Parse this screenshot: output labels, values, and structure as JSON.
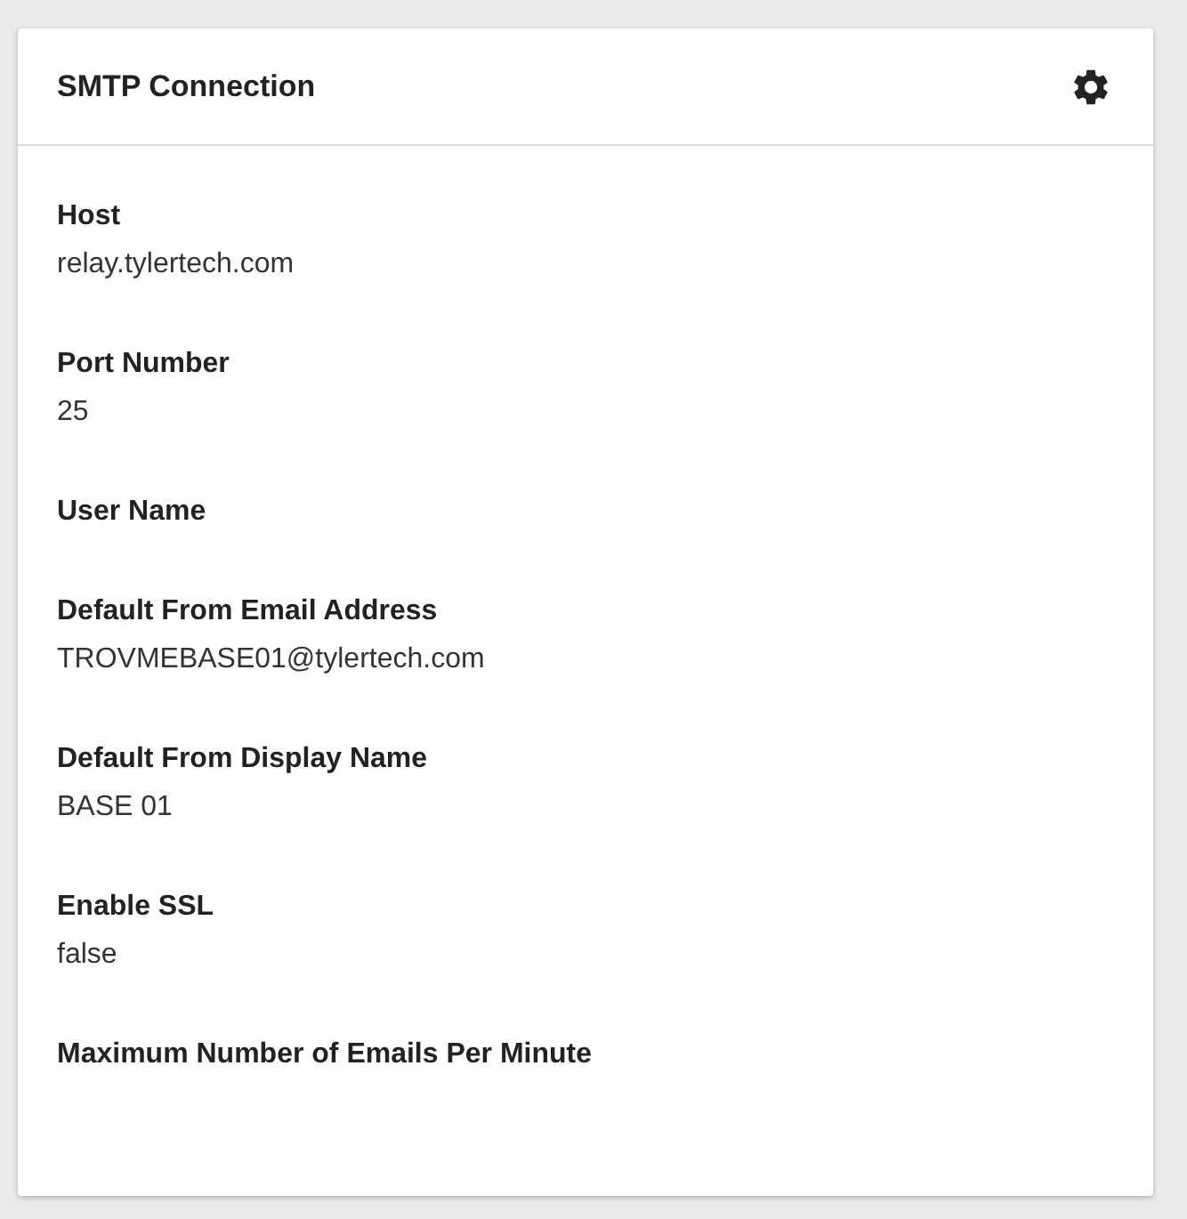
{
  "card": {
    "title": "SMTP Connection"
  },
  "fields": [
    {
      "label": "Host",
      "value": "relay.tylertech.com"
    },
    {
      "label": "Port Number",
      "value": "25"
    },
    {
      "label": "User Name"
    },
    {
      "label": "Default From Email Address",
      "value": "TROVMEBASE01@tylertech.com"
    },
    {
      "label": "Default From Display Name",
      "value": "BASE 01"
    },
    {
      "label": "Enable SSL",
      "value": "false"
    },
    {
      "label": "Maximum Number of Emails Per Minute"
    }
  ]
}
